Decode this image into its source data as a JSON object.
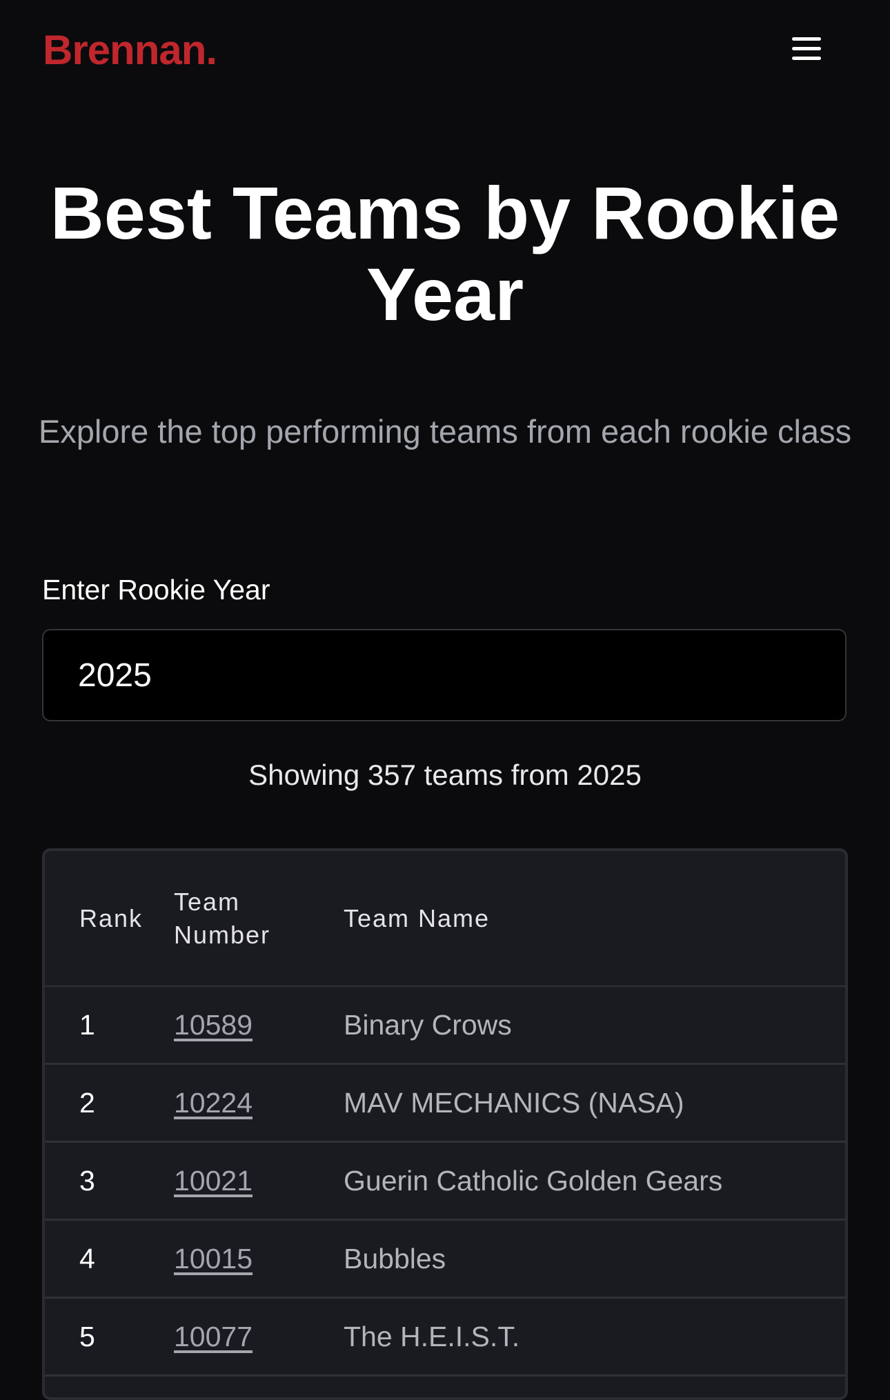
{
  "header": {
    "logo_text": "Brennan",
    "logo_dot": ".",
    "menu_icon": "hamburger-menu-icon",
    "brand_color": "#c0272d"
  },
  "main": {
    "title_line1": "Best Teams by Rookie",
    "title_line2": "Year",
    "subtitle": "Explore the top performing teams from each rookie class",
    "year_label": "Enter Rookie Year",
    "year_value": "2025",
    "showing_text": "Showing 357 teams from 2025"
  },
  "table": {
    "headers": {
      "rank": "Rank",
      "team_number_line1": "Team",
      "team_number_line2": "Number",
      "team_name": "Team Name"
    },
    "rows": [
      {
        "rank": "1",
        "number": "10589",
        "name": "Binary Crows"
      },
      {
        "rank": "2",
        "number": "10224",
        "name": "MAV MECHANICS (NASA)"
      },
      {
        "rank": "3",
        "number": "10021",
        "name": "Guerin Catholic Golden Gears"
      },
      {
        "rank": "4",
        "number": "10015",
        "name": "Bubbles"
      },
      {
        "rank": "5",
        "number": "10077",
        "name": "The H.E.I.S.T."
      },
      {
        "rank": "",
        "number": "",
        "name": ""
      }
    ]
  }
}
